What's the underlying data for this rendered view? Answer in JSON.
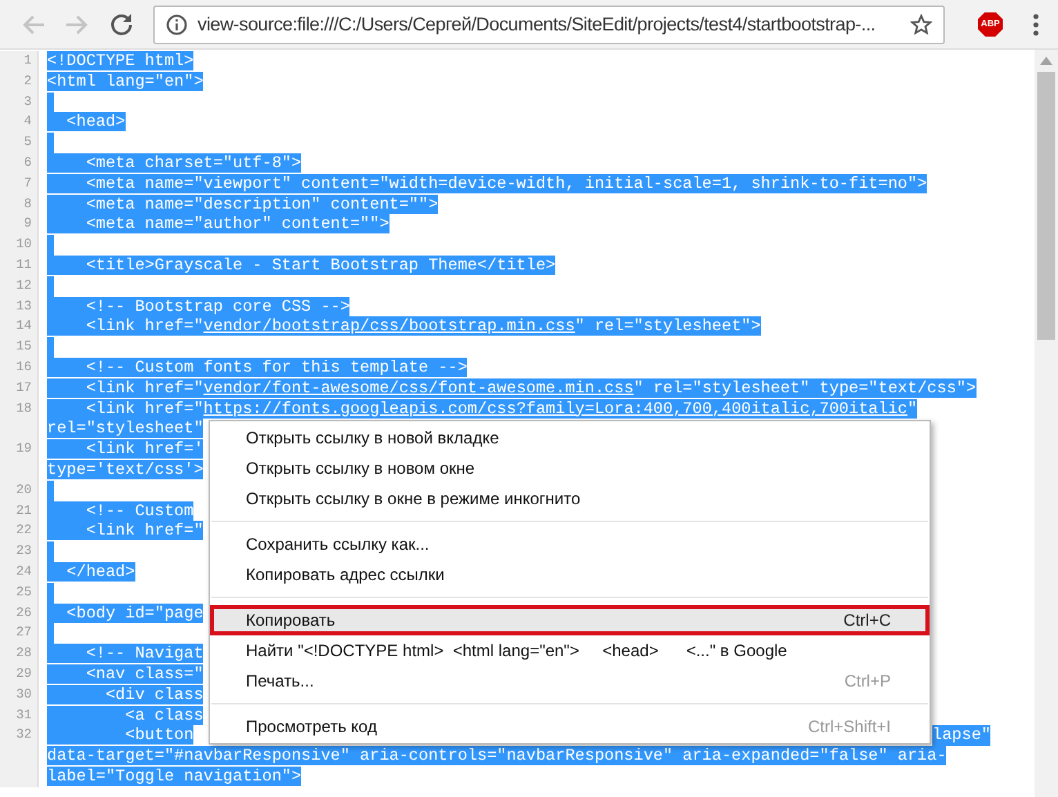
{
  "toolbar": {
    "back": {
      "disabled": true
    },
    "forward": {
      "disabled": true
    },
    "address": "view-source:file:///C:/Users/Сергей/Documents/SiteEdit/projects/test4/startbootstrap-...",
    "extension_badge": "ABP"
  },
  "source": {
    "selected": true,
    "lines": [
      {
        "number": "1",
        "rows": [
          [
            "<!DOCTYPE html>"
          ]
        ]
      },
      {
        "number": "2",
        "rows": [
          [
            "<html lang=\"en\">"
          ]
        ]
      },
      {
        "number": "3",
        "rows": [
          []
        ]
      },
      {
        "number": "4",
        "rows": [
          [
            "  <head>"
          ]
        ]
      },
      {
        "number": "5",
        "rows": [
          []
        ]
      },
      {
        "number": "6",
        "rows": [
          [
            "    <meta charset=\"utf-8\">"
          ]
        ]
      },
      {
        "number": "7",
        "rows": [
          [
            "    <meta name=\"viewport\" content=\"width=device-width, initial-scale=1, shrink-to-fit=no\">"
          ]
        ]
      },
      {
        "number": "8",
        "rows": [
          [
            "    <meta name=\"description\" content=\"\">"
          ]
        ]
      },
      {
        "number": "9",
        "rows": [
          [
            "    <meta name=\"author\" content=\"\">"
          ]
        ]
      },
      {
        "number": "10",
        "rows": [
          []
        ]
      },
      {
        "number": "11",
        "rows": [
          [
            "    <title>Grayscale - Start Bootstrap Theme</title>"
          ]
        ]
      },
      {
        "number": "12",
        "rows": [
          []
        ]
      },
      {
        "number": "13",
        "rows": [
          [
            "    <!-- Bootstrap core CSS -->"
          ]
        ]
      },
      {
        "number": "14",
        "rows": [
          [
            "    <link href=\"",
            {
              "link": "vendor/bootstrap/css/bootstrap.min.css"
            },
            "\" rel=\"stylesheet\">"
          ]
        ]
      },
      {
        "number": "15",
        "rows": [
          []
        ]
      },
      {
        "number": "16",
        "rows": [
          [
            "    <!-- Custom fonts for this template -->"
          ]
        ]
      },
      {
        "number": "17",
        "rows": [
          [
            "    <link href=\"",
            {
              "link": "vendor/font-awesome/css/font-awesome.min.css"
            },
            "\" rel=\"stylesheet\" type=\"text/css\">"
          ]
        ]
      },
      {
        "number": "18",
        "rows": [
          [
            "    <link href=\"",
            {
              "link": "https://fonts.googleapis.com/css?family=Lora:400,700,400italic,700italic"
            },
            "\""
          ],
          [
            "rel=\"stylesheet\""
          ]
        ]
      },
      {
        "number": "19",
        "rows": [
          [
            "    <link href='"
          ],
          [
            "type='text/css'>"
          ]
        ]
      },
      {
        "number": "20",
        "rows": [
          []
        ]
      },
      {
        "number": "21",
        "rows": [
          [
            "    <!-- Custom"
          ]
        ]
      },
      {
        "number": "22",
        "rows": [
          [
            "    <link href=\""
          ]
        ]
      },
      {
        "number": "23",
        "rows": [
          []
        ]
      },
      {
        "number": "24",
        "rows": [
          [
            "  </head>"
          ]
        ]
      },
      {
        "number": "25",
        "rows": [
          []
        ]
      },
      {
        "number": "26",
        "rows": [
          [
            "  <body id=\"page"
          ]
        ]
      },
      {
        "number": "27",
        "rows": [
          []
        ]
      },
      {
        "number": "28",
        "rows": [
          [
            "    <!-- Navigat"
          ]
        ]
      },
      {
        "number": "29",
        "rows": [
          [
            "    <nav class=\""
          ]
        ]
      },
      {
        "number": "30",
        "rows": [
          [
            "      <div class"
          ]
        ]
      },
      {
        "number": "31",
        "rows": [
          [
            "        <a class"
          ]
        ]
      },
      {
        "number": "32",
        "tail": "lapse\"",
        "rows": [
          [
            "        <button"
          ],
          [
            "data-target=\"#navbarResponsive\" aria-controls=\"navbarResponsive\" aria-expanded=\"false\" aria-"
          ],
          [
            "label=\"Toggle navigation\">"
          ]
        ]
      }
    ]
  },
  "context_menu": {
    "items": [
      {
        "kind": "item",
        "label": "Открыть ссылку в новой вкладке",
        "selected": false
      },
      {
        "kind": "item",
        "label": "Открыть ссылку в новом окне",
        "selected": false
      },
      {
        "kind": "item",
        "label": "Открыть ссылку в окне в режиме инкогнито",
        "selected": false
      },
      {
        "kind": "separator"
      },
      {
        "kind": "item",
        "label": "Сохранить ссылку как...",
        "selected": false
      },
      {
        "kind": "item",
        "label": "Копировать адрес ссылки",
        "selected": false
      },
      {
        "kind": "separator"
      },
      {
        "kind": "item",
        "label": "Копировать",
        "shortcut": "Ctrl+C",
        "selected": true,
        "annotated": true
      },
      {
        "kind": "item",
        "label": "Найти \"<!DOCTYPE html>  <html lang=\"en\">     <head>      <...\" в Google",
        "selected": false
      },
      {
        "kind": "item",
        "label": "Печать...",
        "shortcut": "Ctrl+P",
        "selected": false
      },
      {
        "kind": "separator"
      },
      {
        "kind": "item",
        "label": "Просмотреть код",
        "shortcut": "Ctrl+Shift+I",
        "selected": false
      }
    ]
  }
}
